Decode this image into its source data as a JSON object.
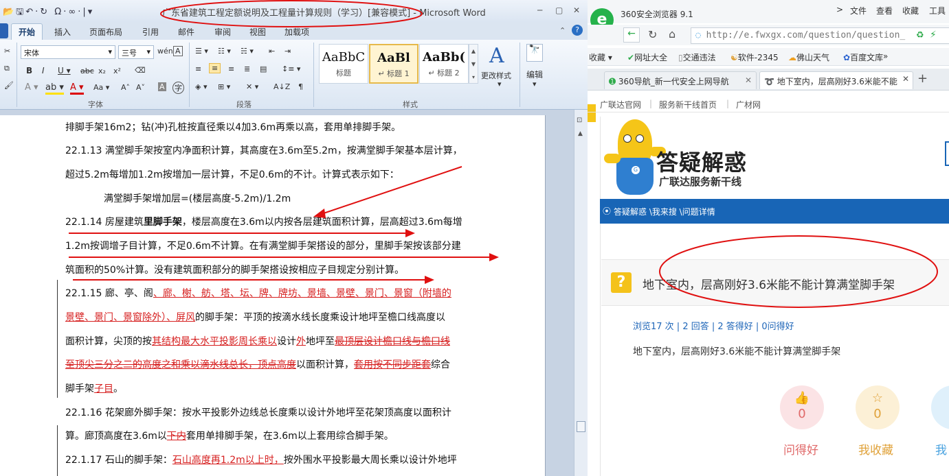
{
  "word": {
    "quick_access": "📂🖫↶·↻ Ω·∞·|▾",
    "title": "广东省建筑工程定额说明及工程量计算规则（学习）[兼容模式] - Microsoft Word",
    "win_controls": [
      "─",
      "▢",
      "✕"
    ],
    "tabs": [
      "开始",
      "插入",
      "页面布局",
      "引用",
      "邮件",
      "审阅",
      "视图",
      "加载项"
    ],
    "ribbon": {
      "font_name": "宋体",
      "font_size": "三号",
      "groups": [
        "字体",
        "段落",
        "样式"
      ],
      "styles": [
        {
          "preview": "AaBbC",
          "name": "标题"
        },
        {
          "preview": "AaBl",
          "name": "↵ 标题 1"
        },
        {
          "preview": "AaBb(",
          "name": "↵ 标题 2"
        }
      ],
      "change_styles": "更改样式",
      "edit": "编辑"
    },
    "doc_lines": {
      "l1": "排脚手架16m2；钻(冲)孔桩按直径乘以4加3.6m再乘以高，套用单排脚手架。",
      "l2": "22.1.13 满堂脚手架按室内净面积计算，其高度在3.6m至5.2m，按满堂脚手架基本层计算，",
      "l3": "超过5.2m每增加1.2m按增加一层计算，不足0.6m的不计。计算式表示如下：",
      "l4": "满堂脚手架增加层=(楼层高度-5.2m)/1.2m",
      "l5a": "22.1.14 房屋建筑",
      "l5b": "里脚手架",
      "l5c": "，楼层高度在3.6m以内按各层建筑面积计算，层高超过3.6m每增",
      "l6": "1.2m按调增子目计算，不足0.6m不计算。在有满堂脚手架搭设的部分，里脚手架按该部分建",
      "l7": "筑面积的50%计算。没有建筑面积部分的脚手架搭设按相应子目规定分别计算。",
      "l8a": "22.1.15 廊、亭、阁",
      "l8b": "、廊、榭、舫、塔、坛、牌、牌坊、景墙、景壁、景门、景窗（附墙的",
      "l9a": "景壁、景门、景窗除外）、屏风",
      "l9b": "的脚手架：平顶的按滴水线长度乘设计地坪至檐口线高度以",
      "l10a": "面积计算，尖顶的按",
      "l10b": "其结构最大水平投影周长乘以",
      "l10c": "设计",
      "l10d": "外",
      "l10e": "地坪至",
      "l10f": "最顶层设计檐口线与檐口线",
      "l11a": "至顶尖三分之二的高度之和乘以滴水线总长，顶点高度",
      "l11b": "以面积计算，",
      "l11c": "套用按不同步距套",
      "l11d": "综合",
      "l12a": "脚手架",
      "l12b": "子目",
      "l12c": "。",
      "l13": "22.1.16 花架廊外脚手架：按水平投影外边线总长度乘以设计外地坪至花架顶高度以面积计",
      "l14a": "算。廊顶高度在3.6m以",
      "l14b": "下内",
      "l14c": "套用单排脚手架，在3.6m以上套用综合脚手架。",
      "l15a": "22.1.17 石山的脚手架：",
      "l15b": "石山高度再1.2m以上时，",
      "l15c": "按外围水平投影最大周长乘以设计外地坪"
    }
  },
  "browser": {
    "app_name": "360安全浏览器 9.1",
    "menu": [
      ">",
      "文件",
      "查看",
      "收藏",
      "工具"
    ],
    "address": "http://e.fwxgx.com/question/question_",
    "favorites": [
      "收藏 ▾",
      "网址大全",
      "交通违法",
      "软件-2345",
      "佛山天气",
      "百度文库",
      "»"
    ],
    "tabs": [
      "360导航_新一代安全上网导航",
      "地下室内，层高刚好3.6米能不能"
    ],
    "site_nav": [
      "广联达官网",
      "服务新干线首页",
      "广材网"
    ],
    "banner_title": "答疑解惑",
    "banner_sub": "广联达服务新干线",
    "breadcrumb": "答疑解惑 \\我来搜 \\问题详情",
    "question_title": "地下室内，层高刚好3.6米能不能计算满堂脚手架",
    "stats": "浏览17 次 | 2 回答 | 2 答得好 | 0问得好",
    "question_body": "地下室内，层高刚好3.6米能不能计算满堂脚手架",
    "actions": [
      {
        "count": "0",
        "label": "问得好",
        "color": "#e06a6a",
        "bg": "#fbe3e5"
      },
      {
        "count": "0",
        "label": "我收藏",
        "color": "#e0a23a",
        "bg": "#fcf0d6"
      },
      {
        "count": "",
        "label": "我",
        "color": "#4aa3e0",
        "bg": "#dff0fb"
      }
    ]
  },
  "colors": {
    "accent_blue": "#1865b6",
    "annotation_red": "#e01010",
    "track_red": "#d61f1f"
  }
}
